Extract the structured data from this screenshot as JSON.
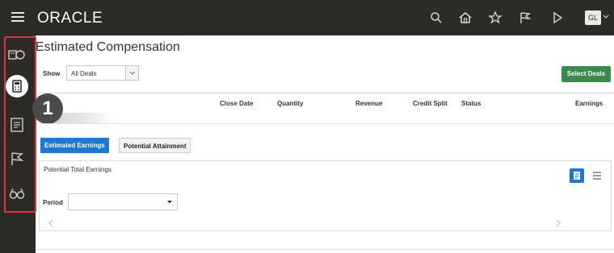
{
  "header": {
    "brand": "ORACLE",
    "icons": [
      "menu-icon",
      "search-icon",
      "home-icon",
      "star-icon",
      "flag-icon",
      "play-icon"
    ],
    "user_initials": "GL"
  },
  "rail": {
    "items": [
      "deals-icon",
      "calculator-icon",
      "document-icon",
      "flag-icon",
      "binoculars-icon"
    ],
    "active": "calculator-icon",
    "highlight_color": "#d9363e"
  },
  "callout": {
    "number": "1"
  },
  "page": {
    "title": "Estimated Compensation"
  },
  "filter": {
    "show_label": "Show",
    "show_value": "All Deals",
    "select_deals_label": "Select Deals"
  },
  "table": {
    "columns": [
      "Close Date",
      "Quantity",
      "Revenue",
      "Credit Split",
      "Status",
      "Earnings"
    ]
  },
  "tabs": [
    {
      "label": "Estimated Earnings",
      "active": true
    },
    {
      "label": "Potential Attainment",
      "active": false
    }
  ],
  "panel": {
    "title": "Potential Total Earnings",
    "period_label": "Period",
    "period_value": ""
  },
  "colors": {
    "topbar": "#2d2b27",
    "accent_blue": "#1e78cf",
    "accent_green": "#3a8a4d"
  }
}
